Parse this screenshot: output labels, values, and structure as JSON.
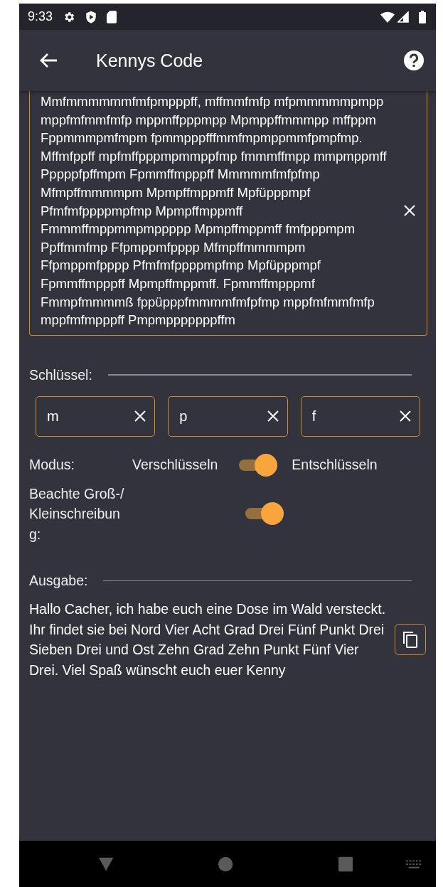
{
  "status_bar": {
    "time": "9:33"
  },
  "app_bar": {
    "title": "Kennys Code"
  },
  "input": {
    "value": "Mmfmmmmmmfmfpmpppff, mffmmfmfp mfpmmmmmpmpp mppfmfmmfmfp mppmffpppmpp Mpmppffmmmpp mffppm Fppmmmpmfmpm fpmmpppfffmmfmpmppmmfpmpfmp. Mffmfppff mpfmffpppmpmmppfmp fmmmffmpp mmpmppmff Pppppfpffmpm Fpmmffmpppff Mmmmmfmfpfmp Mfmpffmmmmpm Mpmpffmppmff Mpfüpppmpf Pfmfmfppppmpfmp Mpmpffmppmff Fmmmffmppmmpmppppp Mpmpffmppmff fmfpppmpm Ppffmmfmp Ffpmppmfpppp Mfmpffmmmmpm Ffpmppmfpppp Pfmfmfppppmpfmp Mpfüpppmpf Fpmmffmpppff Mpmpffmppmff. Fpmmffmpppmf Fmmpfmmmmß fppüpppfmmmmfmfpfmp mppfmfmmfmfp mppfmfmpppff Pmpmpppppppffm"
  },
  "key_section": {
    "label": "Schlüssel:"
  },
  "keys": [
    {
      "value": "m"
    },
    {
      "value": "p"
    },
    {
      "value": "f"
    }
  ],
  "mode": {
    "label": "Modus:",
    "left_option": "Verschlüsseln",
    "right_option": "Entschlüsseln",
    "on": true
  },
  "case_sensitive": {
    "label": "Beachte Groß-/Kleinschreibung:",
    "on": true
  },
  "output": {
    "label": "Ausgabe:",
    "text": "Hallo Cacher, ich habe euch eine Dose im Wald versteckt. Ihr findet sie bei Nord Vier Acht Grad Drei Fünf Punkt Drei Sieben Drei und Ost Zehn Grad Zehn Punkt Fünf Vier Drei. Viel Spaß wünscht euch euer Kenny"
  }
}
